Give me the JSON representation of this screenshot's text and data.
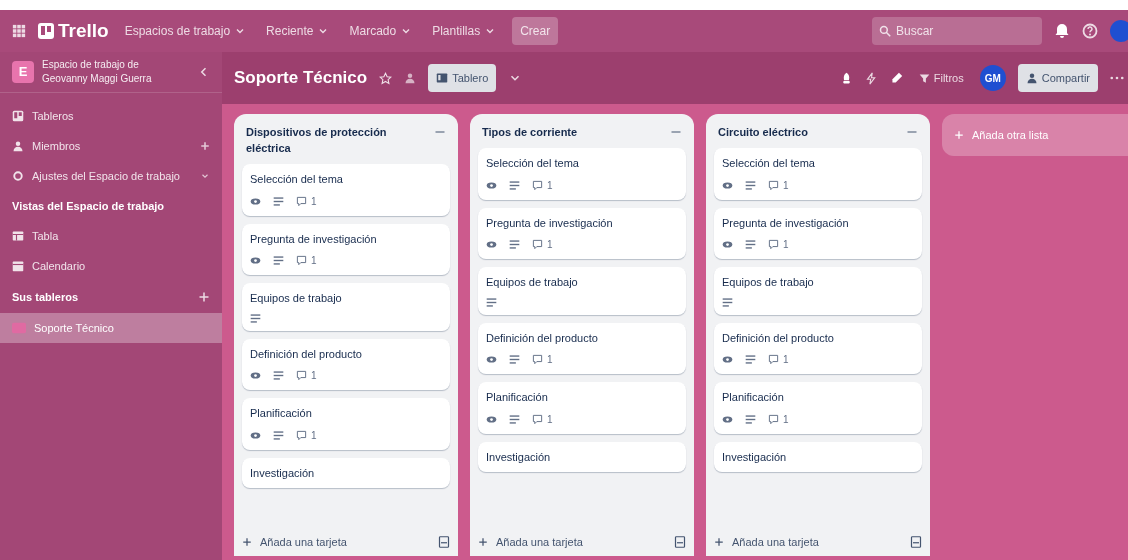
{
  "topbar": {
    "logo": "Trello",
    "menus": [
      {
        "label": "Espacios de trabajo"
      },
      {
        "label": "Reciente"
      },
      {
        "label": "Marcado"
      },
      {
        "label": "Plantillas"
      }
    ],
    "create": "Crear",
    "search": {
      "placeholder": "Buscar"
    }
  },
  "sidebar": {
    "workspace": {
      "initial": "E",
      "name": "Espacio de trabajo de Geovanny Maggi Guerra"
    },
    "items": [
      {
        "kind": "board",
        "label": "Tableros"
      },
      {
        "kind": "members",
        "label": "Miembros"
      },
      {
        "kind": "settings",
        "label": "Ajustes del Espacio de trabajo"
      }
    ],
    "views_heading": "Vistas del Espacio de trabajo",
    "views": [
      {
        "kind": "table",
        "label": "Tabla"
      },
      {
        "kind": "calendar",
        "label": "Calendario"
      }
    ],
    "boards_heading": "Sus tableros",
    "boards": [
      {
        "label": "Soporte Técnico",
        "selected": true
      }
    ]
  },
  "board_header": {
    "title": "Soporte Técnico",
    "starred": false,
    "view": "Tablero",
    "filter": "Filtros",
    "avatar": "GM",
    "share": "Compartir"
  },
  "lists": [
    {
      "title": "Dispositivos de protección eléctrica",
      "cards": [
        {
          "title": "Selección del tema",
          "watching": true,
          "description": true,
          "comments": "1"
        },
        {
          "title": "Pregunta de investigación",
          "watching": true,
          "description": true,
          "comments": "1"
        },
        {
          "title": "Equipos de trabajo",
          "watching": false,
          "description": true
        },
        {
          "title": "Definición del producto",
          "watching": true,
          "description": true,
          "comments": "1"
        },
        {
          "title": "Planificación",
          "watching": true,
          "description": true,
          "comments": "1"
        },
        {
          "title": "Investigación",
          "watching": false,
          "description": false
        }
      ],
      "add_card": "Añada una tarjeta"
    },
    {
      "title": "Tipos de corriente",
      "cards": [
        {
          "title": "Selección del tema",
          "watching": true,
          "description": true,
          "comments": "1"
        },
        {
          "title": "Pregunta de investigación",
          "watching": true,
          "description": true,
          "comments": "1"
        },
        {
          "title": "Equipos de trabajo",
          "watching": false,
          "description": true
        },
        {
          "title": "Definición del producto",
          "watching": true,
          "description": true,
          "comments": "1"
        },
        {
          "title": "Planificación",
          "watching": true,
          "description": true,
          "comments": "1"
        },
        {
          "title": "Investigación",
          "watching": false,
          "description": false
        }
      ],
      "add_card": "Añada una tarjeta"
    },
    {
      "title": "Circuito eléctrico",
      "cards": [
        {
          "title": "Selección del tema",
          "watching": true,
          "description": true,
          "comments": "1"
        },
        {
          "title": "Pregunta de investigación",
          "watching": true,
          "description": true,
          "comments": "1"
        },
        {
          "title": "Equipos de trabajo",
          "watching": false,
          "description": true
        },
        {
          "title": "Definición del producto",
          "watching": true,
          "description": true,
          "comments": "1"
        },
        {
          "title": "Planificación",
          "watching": true,
          "description": true,
          "comments": "1"
        },
        {
          "title": "Investigación",
          "watching": false,
          "description": false
        }
      ],
      "add_card": "Añada una tarjeta"
    }
  ],
  "add_list": "Añada otra lista"
}
